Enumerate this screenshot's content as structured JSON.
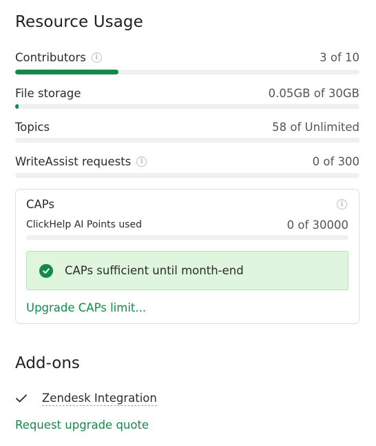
{
  "resource_usage": {
    "title": "Resource Usage",
    "items": [
      {
        "label": "Contributors",
        "value": "3 of 10",
        "has_info": true,
        "used": 3,
        "limit": 10
      },
      {
        "label": "File storage",
        "value": "0.05GB of 30GB",
        "has_info": false,
        "used": 0.05,
        "limit": 30
      },
      {
        "label": "Topics",
        "value": "58 of Unlimited",
        "has_info": false,
        "used": 58,
        "limit": null
      },
      {
        "label": "WriteAssist requests",
        "value": "0 of 300",
        "has_info": true,
        "used": 0,
        "limit": 300
      }
    ]
  },
  "caps": {
    "title": "CAPs",
    "subtitle": "ClickHelp AI Points used",
    "value": "0 of 30000",
    "used": 0,
    "limit": 30000,
    "notice": "CAPs sufficient until month-end",
    "upgrade_link": "Upgrade CAPs limit..."
  },
  "addons": {
    "title": "Add-ons",
    "items": [
      {
        "name": "Zendesk Integration",
        "enabled": true
      }
    ],
    "request_link": "Request upgrade quote"
  },
  "colors": {
    "accent": "#138a4a",
    "track": "#f0f0f0",
    "notice_bg": "#e0f5dd"
  },
  "icons": {
    "info": "info-circle-icon",
    "check_circle": "check-circle-icon",
    "check": "check-icon"
  }
}
